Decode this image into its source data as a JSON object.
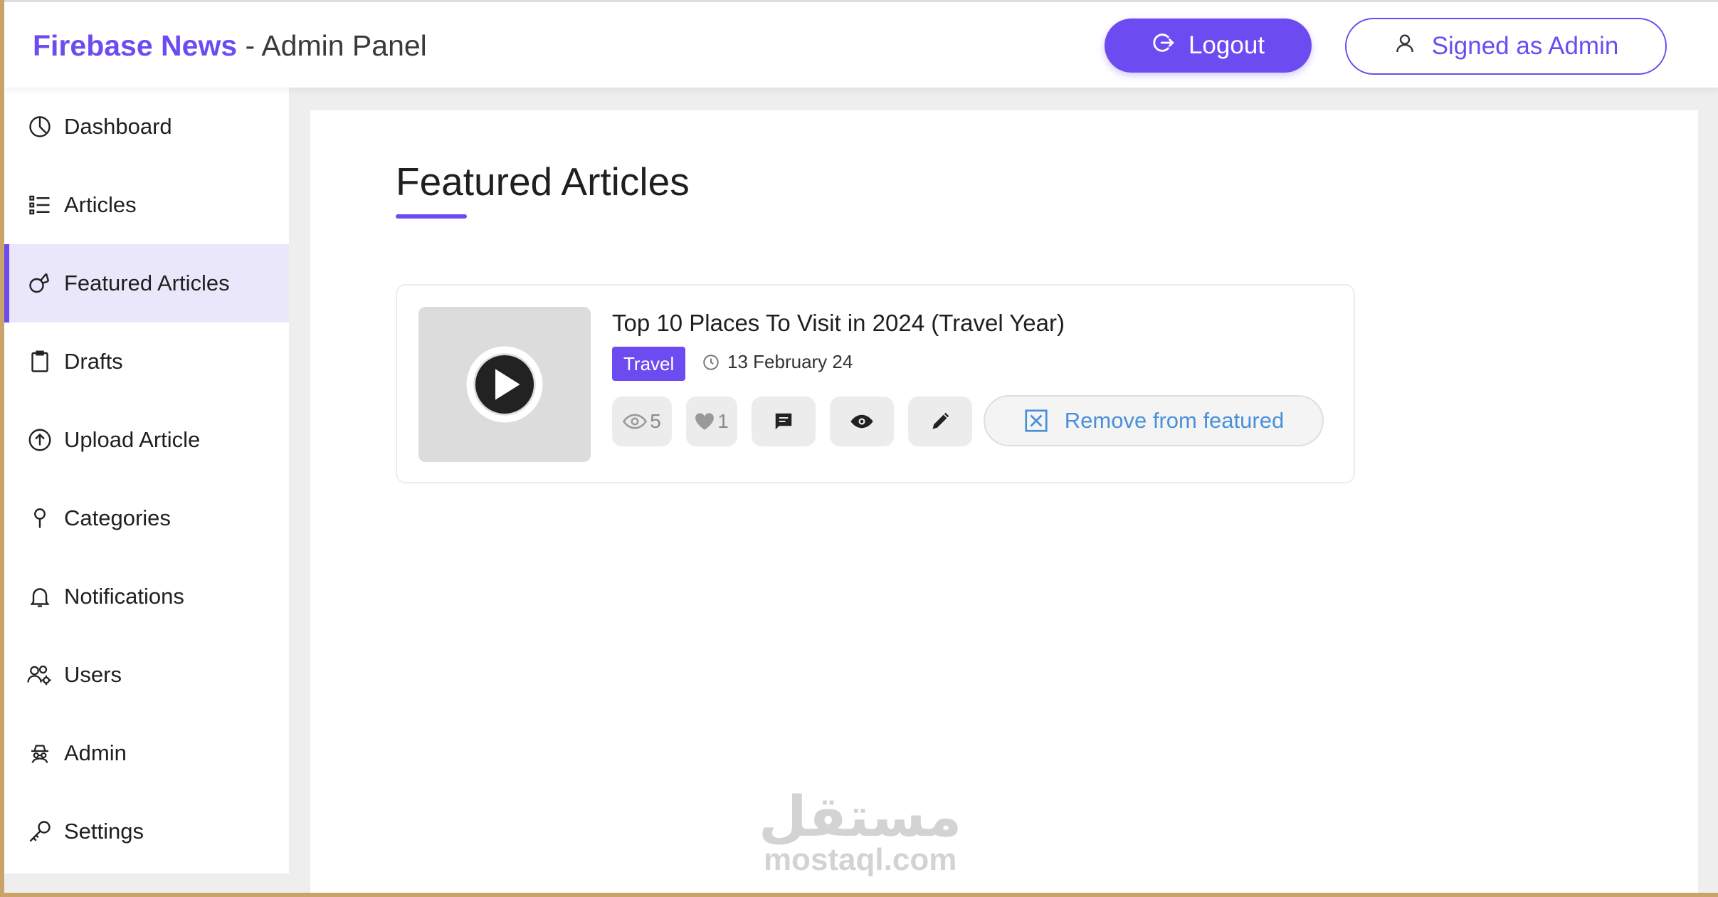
{
  "header": {
    "brand_name": "Firebase News",
    "brand_sub": " - Admin Panel",
    "logout_label": "Logout",
    "signed_label": "Signed as Admin"
  },
  "sidebar": {
    "items": [
      {
        "label": "Dashboard",
        "icon": "pie-chart-icon"
      },
      {
        "label": "Articles",
        "icon": "list-icon"
      },
      {
        "label": "Featured Articles",
        "icon": "featured-icon",
        "active": true
      },
      {
        "label": "Drafts",
        "icon": "clipboard-icon"
      },
      {
        "label": "Upload Article",
        "icon": "upload-icon"
      },
      {
        "label": "Categories",
        "icon": "pin-icon"
      },
      {
        "label": "Notifications",
        "icon": "bell-icon"
      },
      {
        "label": "Users",
        "icon": "users-gear-icon"
      },
      {
        "label": "Admin",
        "icon": "admin-icon"
      },
      {
        "label": "Settings",
        "icon": "key-icon"
      }
    ]
  },
  "main": {
    "title": "Featured Articles",
    "article": {
      "title": "Top 10 Places To Visit in 2024 (Travel Year)",
      "category": "Travel",
      "date": "13 February 24",
      "views": "5",
      "likes": "1",
      "remove_label": "Remove from featured"
    }
  },
  "watermark": {
    "arabic": "مستقل",
    "latin": "mostaql.com"
  },
  "colors": {
    "accent": "#6c4cf1",
    "link": "#4a90d9"
  }
}
